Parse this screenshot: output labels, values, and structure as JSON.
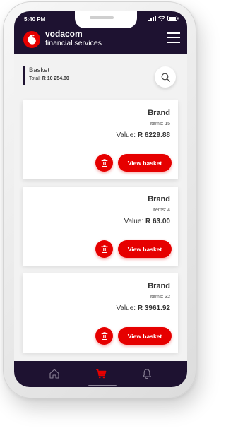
{
  "status": {
    "time": "5:40 PM"
  },
  "brand": {
    "name": "vodacom",
    "subtitle": "financial services",
    "color": "#e60000"
  },
  "header": {
    "bg": "#1e1231"
  },
  "basket": {
    "title": "Basket",
    "total_label": "Total:",
    "total_value": "R 10 254.80"
  },
  "cards": [
    {
      "brand": "Brand",
      "items": "Items: 15",
      "value_label": "Value:",
      "value": "R 6229.88",
      "button": "View basket"
    },
    {
      "brand": "Brand",
      "items": "Items: 4",
      "value_label": "Value:",
      "value": "R 63.00",
      "button": "View basket"
    },
    {
      "brand": "Brand",
      "items": "Items: 32",
      "value_label": "Value:",
      "value": "R 3961.92",
      "button": "View basket"
    }
  ],
  "nav": {
    "items": [
      "home-icon",
      "cart-icon",
      "bell-icon"
    ],
    "active": "cart-icon"
  }
}
